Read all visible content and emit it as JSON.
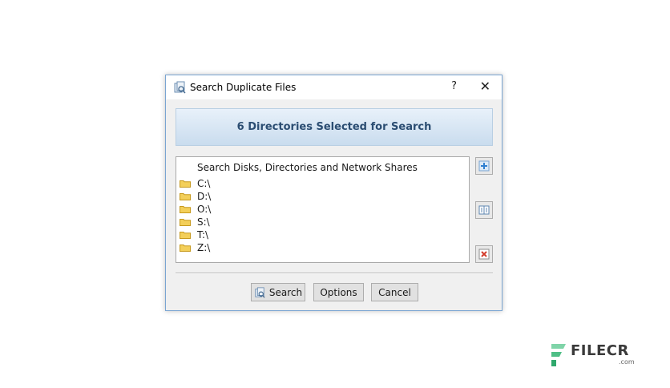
{
  "window": {
    "title": "Search Duplicate Files",
    "help_label": "?",
    "close_label": "✕"
  },
  "banner": {
    "text": "6 Directories Selected for Search"
  },
  "list": {
    "header": "Search Disks, Directories and Network Shares",
    "items": [
      {
        "label": "C:\\"
      },
      {
        "label": "D:\\"
      },
      {
        "label": "O:\\"
      },
      {
        "label": "S:\\"
      },
      {
        "label": "T:\\"
      },
      {
        "label": "Z:\\"
      }
    ]
  },
  "side_buttons": {
    "add": "add-icon",
    "edit": "edit-icon",
    "remove": "remove-icon"
  },
  "buttons": {
    "search": "Search",
    "options": "Options",
    "cancel": "Cancel"
  },
  "watermark": {
    "brand": "FILECR",
    "domain": ".com"
  },
  "colors": {
    "banner_text": "#2b4d72",
    "folder": "#f3cf5a",
    "accent_border": "#7aa5d2"
  }
}
